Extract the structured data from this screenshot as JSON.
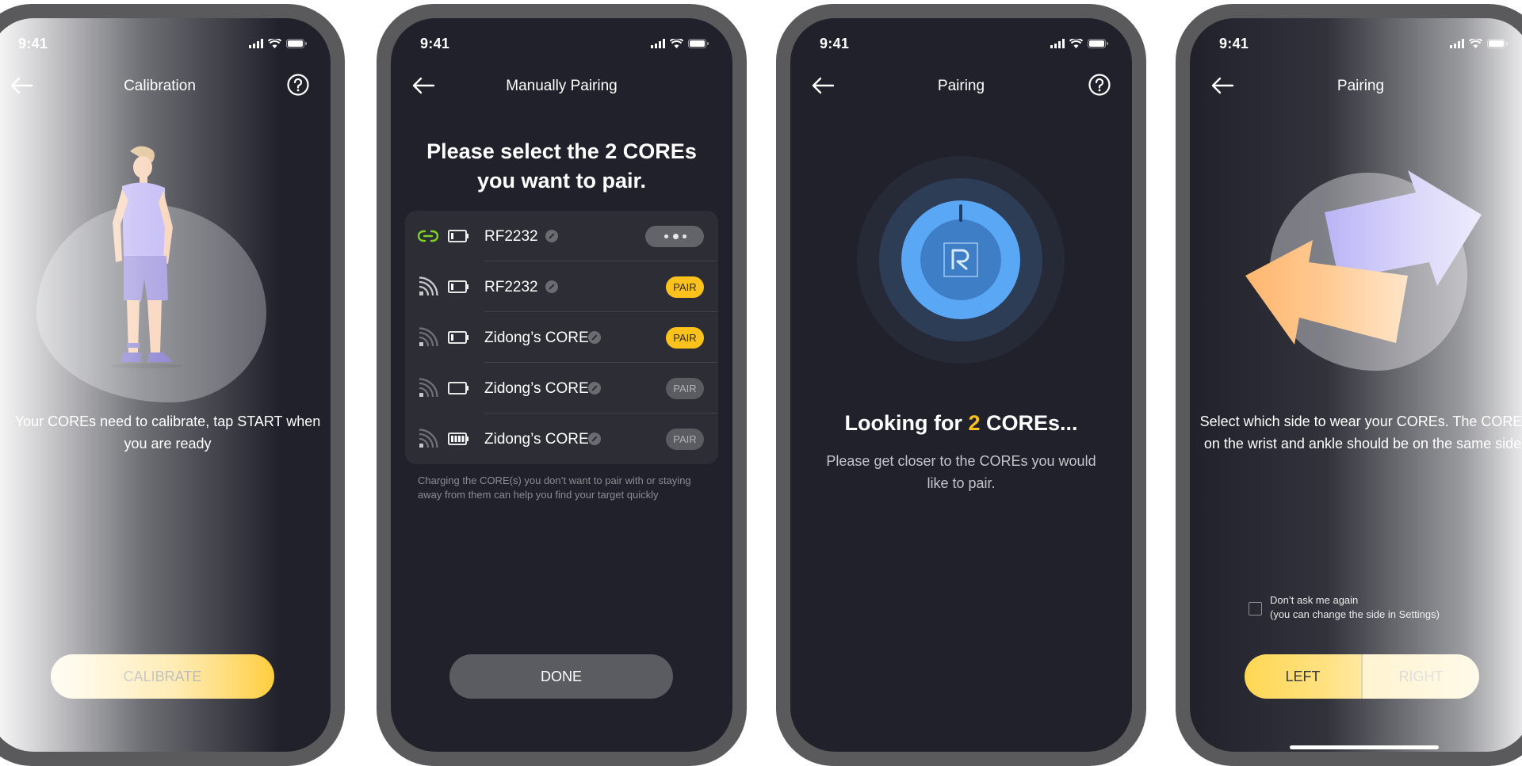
{
  "status_bar": {
    "time": "9:41"
  },
  "calibration_screen": {
    "title": "Calibration",
    "description": "Your COREs need to calibrate, tap START when you are ready",
    "button_label": "CALIBRATE"
  },
  "manual_pairing_screen": {
    "title": "Manually Pairing",
    "heading": "Please select the 2 COREs you want to pair.",
    "cores": [
      {
        "name": "RF2232",
        "signal": "link-icon",
        "battery_level": 0.2,
        "action": "busy"
      },
      {
        "name": "RF2232",
        "signal": "signal-strong-icon",
        "battery_level": 0.2,
        "action": "PAIR",
        "action_state": "active"
      },
      {
        "name": "Zidong’s CORE",
        "signal": "signal-weak-icon",
        "battery_level": 0.2,
        "action": "PAIR",
        "action_state": "active"
      },
      {
        "name": "Zidong’s CORE",
        "signal": "signal-weak-icon",
        "battery_level": 0.0,
        "action": "PAIR",
        "action_state": "inactive"
      },
      {
        "name": "Zidong’s CORE",
        "signal": "signal-weak-icon",
        "battery_level": 1.0,
        "action": "PAIR",
        "action_state": "inactive"
      }
    ],
    "note": "Charging the CORE(s) you don’t want to pair with or staying away from them can help you find your target quickly",
    "done_label": "DONE"
  },
  "pairing_search_screen": {
    "title": "Pairing",
    "title_prefix": "Looking for ",
    "title_count": "2",
    "title_suffix": " COREs...",
    "description": "Please get closer to the COREs you would like to pair."
  },
  "side_select_screen": {
    "title": "Pairing",
    "description": "Select which side to wear your COREs. The COREs on the wrist and ankle should be on the same side.",
    "dont_ask_line1": "Don’t ask me again",
    "dont_ask_line2": "(you can change the side in Settings)",
    "left_label": "LEFT",
    "right_label": "RIGHT"
  },
  "colors": {
    "accent_yellow": "#ffc21c",
    "screen_bg": "#20212a",
    "link_green": "#7ed321",
    "radar_blue": "#5aa8f5"
  }
}
